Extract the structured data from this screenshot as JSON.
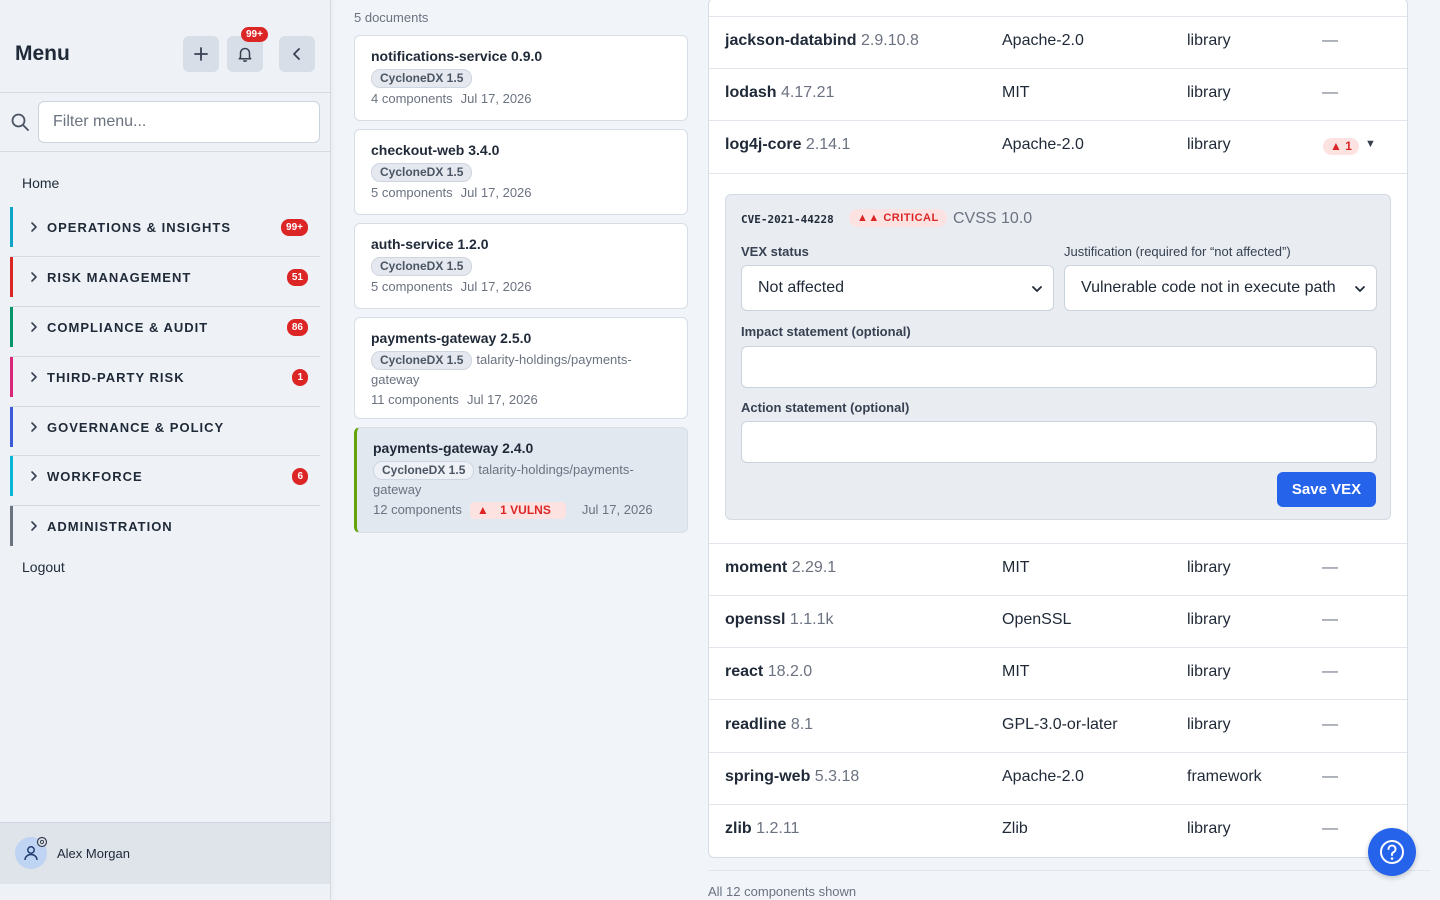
{
  "sidebar": {
    "title": "Menu",
    "notification_count": "99+",
    "search_placeholder": "Filter menu...",
    "home": "Home",
    "logout": "Logout",
    "groups": [
      {
        "label": "OPERATIONS & INSIGHTS",
        "badge": "99+",
        "color": "#0ea5c6"
      },
      {
        "label": "RISK MANAGEMENT",
        "badge": "51",
        "color": "#dc2626"
      },
      {
        "label": "COMPLIANCE & AUDIT",
        "badge": "86",
        "color": "#059669"
      },
      {
        "label": "THIRD-PARTY RISK",
        "badge": "1",
        "color": "#db2777"
      },
      {
        "label": "GOVERNANCE & POLICY",
        "badge": "",
        "color": "#3b5bdb"
      },
      {
        "label": "WORKFORCE",
        "badge": "6",
        "color": "#06b6d4"
      },
      {
        "label": "ADMINISTRATION",
        "badge": "",
        "color": "#6b7280"
      }
    ],
    "user": "Alex Morgan"
  },
  "documents": {
    "count_label": "5 documents",
    "items": [
      {
        "title": "notifications-service 0.9.0",
        "format": "CycloneDX 1.5",
        "source": "",
        "components": "4 components",
        "vulns": "",
        "date": "Jul 17, 2026"
      },
      {
        "title": "checkout-web 3.4.0",
        "format": "CycloneDX 1.5",
        "source": "",
        "components": "5 components",
        "vulns": "",
        "date": "Jul 17, 2026"
      },
      {
        "title": "auth-service 1.2.0",
        "format": "CycloneDX 1.5",
        "source": "",
        "components": "5 components",
        "vulns": "",
        "date": "Jul 17, 2026"
      },
      {
        "title": "payments-gateway 2.5.0",
        "format": "CycloneDX 1.5",
        "source": "talarity-holdings/payments-gateway",
        "components": "11 components",
        "vulns": "",
        "date": "Jul 17, 2026"
      },
      {
        "title": "payments-gateway 2.4.0",
        "format": "CycloneDX 1.5",
        "source": "talarity-holdings/payments-gateway",
        "components": "12 components",
        "vulns": "1 VULNS",
        "date": "Jul 17, 2026"
      }
    ]
  },
  "components": {
    "rows": [
      {
        "name": "jackson-databind",
        "version": "2.9.10.8",
        "license": "Apache-2.0",
        "type": "library",
        "vulns": "—"
      },
      {
        "name": "lodash",
        "version": "4.17.21",
        "license": "MIT",
        "type": "library",
        "vulns": "—"
      },
      {
        "name": "log4j-core",
        "version": "2.14.1",
        "license": "Apache-2.0",
        "type": "library",
        "vulns": "1"
      },
      {
        "name": "moment",
        "version": "2.29.1",
        "license": "MIT",
        "type": "library",
        "vulns": "—"
      },
      {
        "name": "openssl",
        "version": "1.1.1k",
        "license": "OpenSSL",
        "type": "library",
        "vulns": "—"
      },
      {
        "name": "react",
        "version": "18.2.0",
        "license": "MIT",
        "type": "library",
        "vulns": "—"
      },
      {
        "name": "readline",
        "version": "8.1",
        "license": "GPL-3.0-or-later",
        "type": "library",
        "vulns": "—"
      },
      {
        "name": "spring-web",
        "version": "5.3.18",
        "license": "Apache-2.0",
        "type": "framework",
        "vulns": "—"
      },
      {
        "name": "zlib",
        "version": "1.2.11",
        "license": "Zlib",
        "type": "library",
        "vulns": "—"
      }
    ],
    "footer": "All 12 components shown"
  },
  "vex": {
    "cve_id": "CVE-2021-44228",
    "severity": "CRITICAL",
    "cvss": "CVSS 10.0",
    "status_label": "VEX status",
    "status_value": "Not affected",
    "justification_label": "Justification (required for “not affected”)",
    "justification_value": "Vulnerable code not in execute path",
    "impact_label": "Impact statement (optional)",
    "action_label": "Action statement (optional)",
    "save_label": "Save VEX"
  },
  "colors": {
    "accent": "#2563eb",
    "danger": "#dc2626",
    "selected_doc_border": "#65a30d"
  }
}
